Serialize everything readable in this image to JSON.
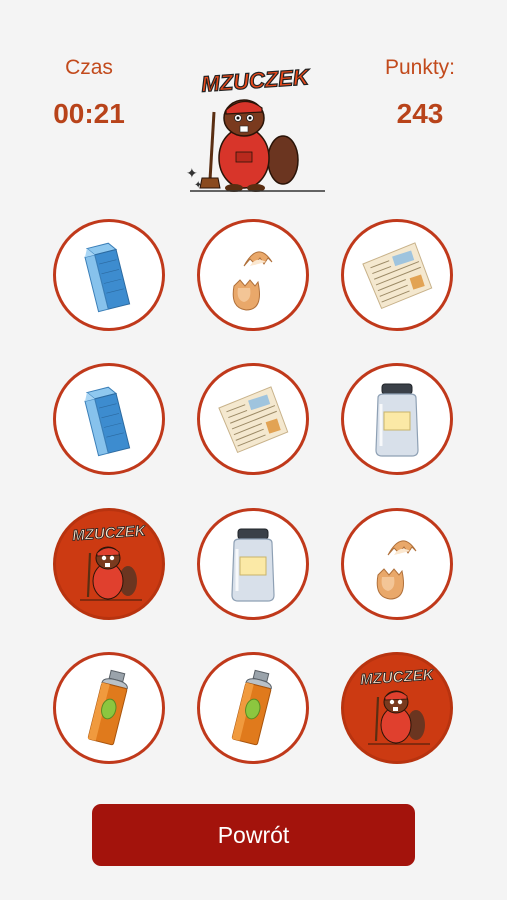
{
  "hud": {
    "time_label": "Czas",
    "time_value": "00:21",
    "points_label": "Punkty:",
    "points_value": "243"
  },
  "logo": {
    "text": "MZUCZEK",
    "icon": "beaver-mascot-icon"
  },
  "cards": [
    {
      "row": 1,
      "col": 1,
      "face": "up",
      "item": "milk-carton"
    },
    {
      "row": 1,
      "col": 2,
      "face": "up",
      "item": "eggshell"
    },
    {
      "row": 1,
      "col": 3,
      "face": "up",
      "item": "newspaper"
    },
    {
      "row": 2,
      "col": 1,
      "face": "up",
      "item": "milk-carton"
    },
    {
      "row": 2,
      "col": 2,
      "face": "up",
      "item": "newspaper"
    },
    {
      "row": 2,
      "col": 3,
      "face": "up",
      "item": "glass-jar"
    },
    {
      "row": 3,
      "col": 1,
      "face": "down",
      "item": "mascot-back"
    },
    {
      "row": 3,
      "col": 2,
      "face": "up",
      "item": "glass-jar"
    },
    {
      "row": 3,
      "col": 3,
      "face": "up",
      "item": "eggshell"
    },
    {
      "row": 4,
      "col": 1,
      "face": "up",
      "item": "spray-can"
    },
    {
      "row": 4,
      "col": 2,
      "face": "up",
      "item": "spray-can"
    },
    {
      "row": 4,
      "col": 3,
      "face": "down",
      "item": "mascot-back"
    }
  ],
  "colors": {
    "accent": "#c24a1c",
    "card_border": "#c0391b",
    "card_back": "#cc3a12",
    "button": "#a3130c"
  },
  "button": {
    "back_label": "Powrót"
  }
}
